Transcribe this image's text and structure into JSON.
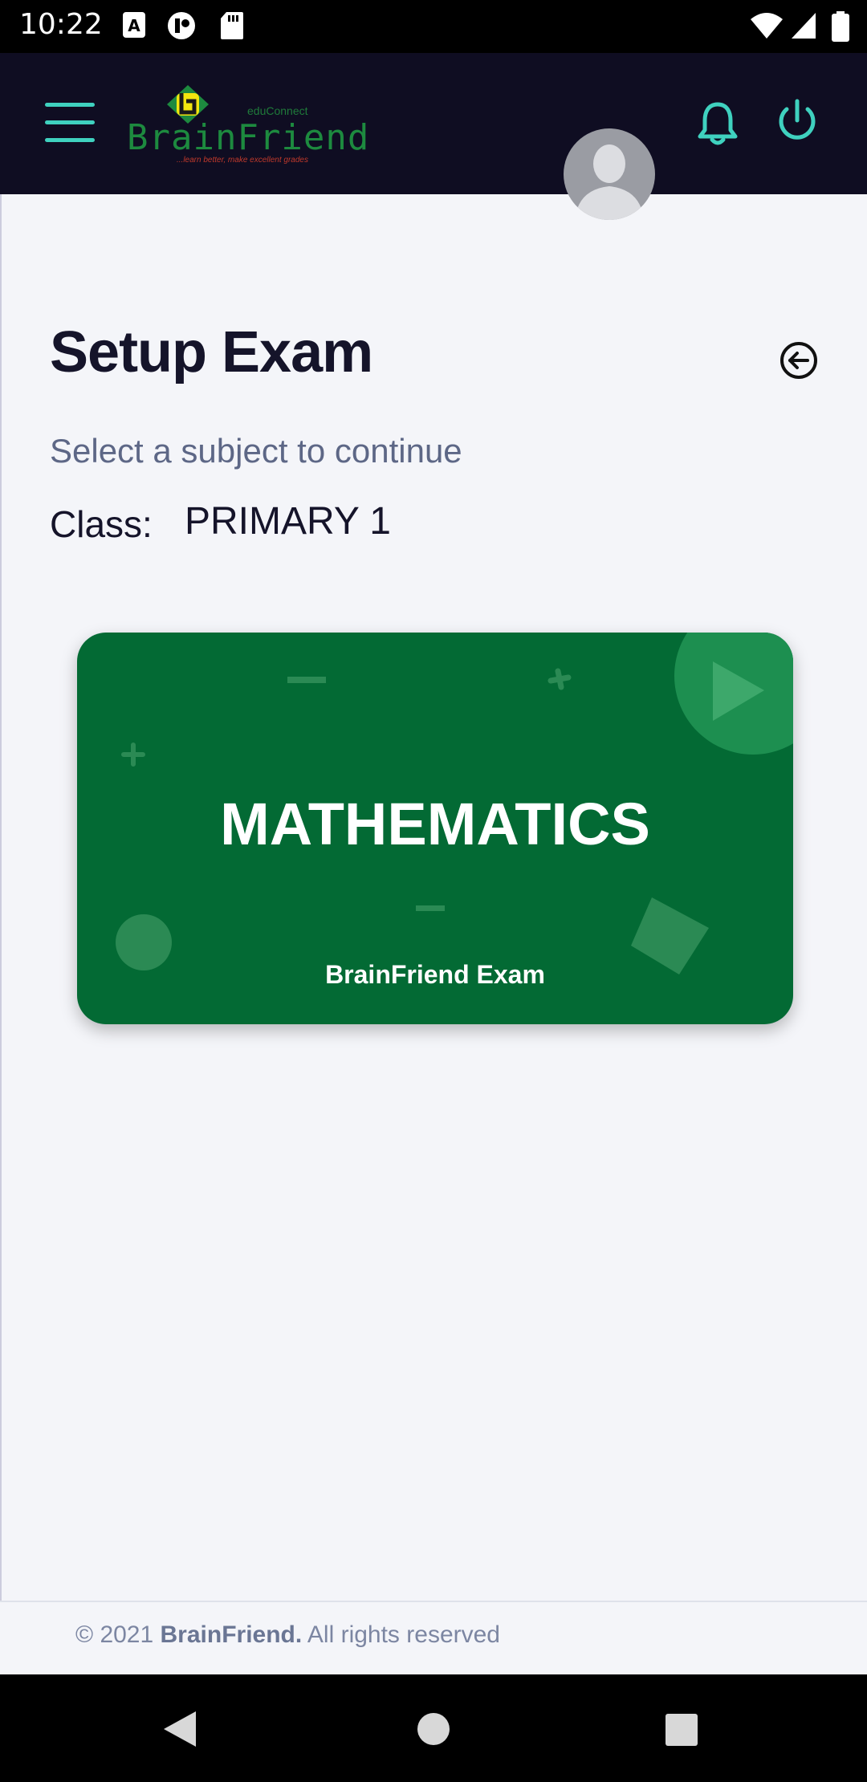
{
  "status_bar": {
    "time": "10:22"
  },
  "header": {
    "logo": {
      "edu": "eduConnect",
      "brand": "BrainFriend",
      "tagline": "...learn better, make excellent grades"
    },
    "menu_icon": "hamburger-menu-icon",
    "notifications_icon": "bell-icon",
    "power_icon": "power-icon",
    "accent_color": "#3fd1bf",
    "background_color": "#0f0d22"
  },
  "page": {
    "title": "Setup Exam",
    "subtitle": "Select a subject to continue",
    "class_label": "Class:",
    "class_value": "PRIMARY 1"
  },
  "subject_card": {
    "subject": "MATHEMATICS",
    "caption": "BrainFriend Exam",
    "color": "#036a34"
  },
  "footer": {
    "prefix": "© 2021 ",
    "brand": "BrainFriend.",
    "suffix": " All rights reserved"
  },
  "nav_bar": {
    "back": "back-icon",
    "home": "home-icon",
    "recents": "recents-icon"
  }
}
